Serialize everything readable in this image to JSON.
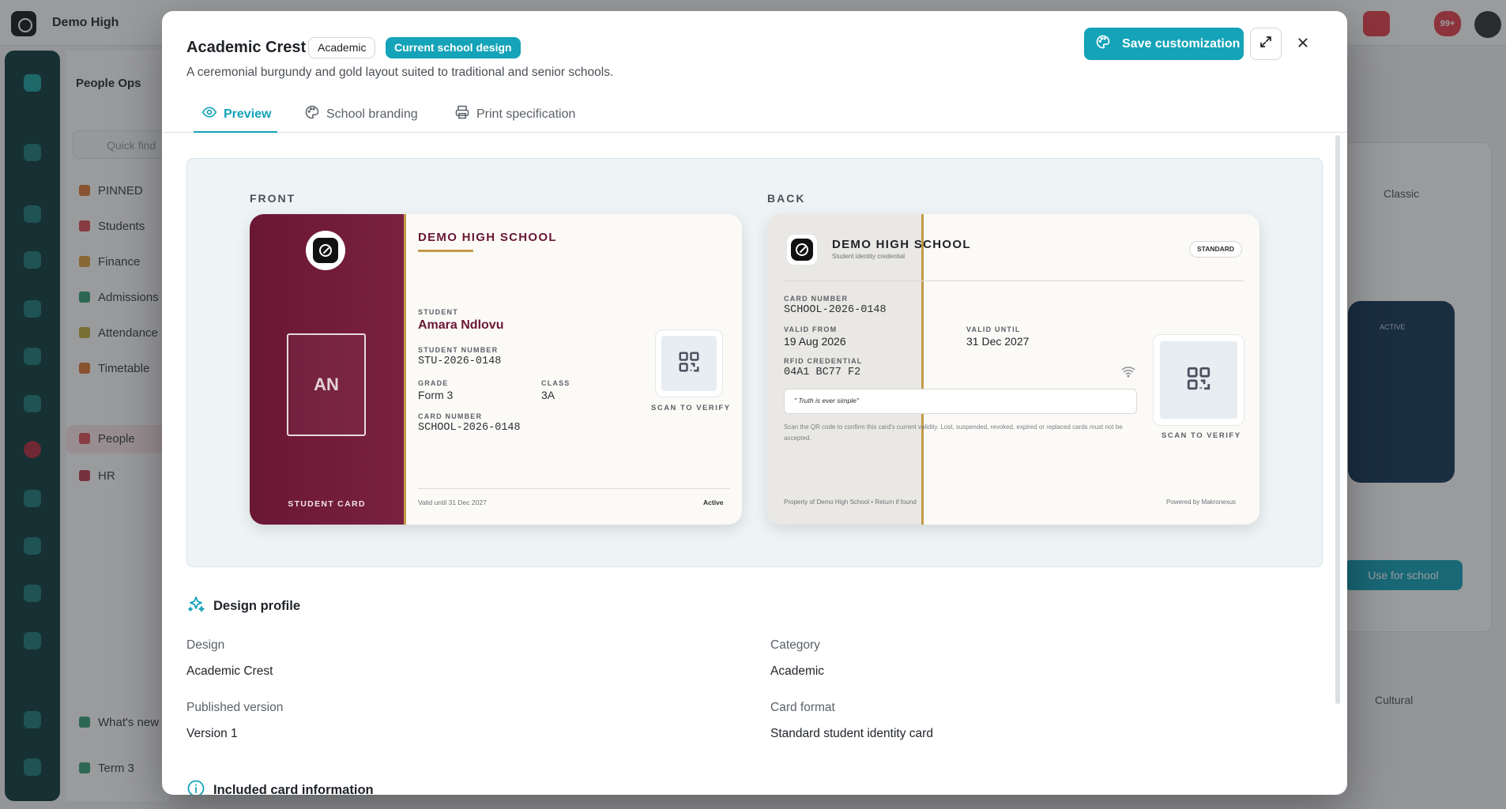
{
  "background": {
    "app_name": "Demo High",
    "section": "People Ops",
    "search_placeholder": "Quick find",
    "nav": [
      {
        "label": "PINNED",
        "color": "#e07a3a"
      },
      {
        "label": "Students",
        "color": "#e0505a"
      },
      {
        "label": "Finance",
        "color": "#e0a040"
      },
      {
        "label": "Admissions",
        "color": "#3aa07a"
      },
      {
        "label": "Attendance",
        "color": "#c0b040"
      },
      {
        "label": "Timetable",
        "color": "#e07a3a"
      },
      {
        "label": "People",
        "color": "#e0505a"
      },
      {
        "label": "HR",
        "color": "#c04050"
      }
    ],
    "whats_new": "What's new",
    "term": "Term 3",
    "notification_count": "99+",
    "right_panel": {
      "classic": "Classic",
      "active": "ACTIVE",
      "use_for_school": "Use for school",
      "cultural": "Cultural"
    }
  },
  "modal": {
    "title": "Academic Crest",
    "category_tag": "Academic",
    "current_tag": "Current school design",
    "subtitle": "A ceremonial burgundy and gold layout suited to traditional and senior schools.",
    "save_label": "Save customization",
    "tabs": [
      {
        "label": "Preview",
        "icon": "eye-icon",
        "active": true
      },
      {
        "label": "School branding",
        "icon": "palette-icon",
        "active": false
      },
      {
        "label": "Print specification",
        "icon": "printer-icon",
        "active": false
      }
    ]
  },
  "preview": {
    "front_label": "FRONT",
    "back_label": "BACK",
    "front": {
      "initials": "AN",
      "role": "STUDENT CARD",
      "school": "DEMO HIGH SCHOOL",
      "student_label": "STUDENT",
      "student_name": "Amara Ndlovu",
      "student_number_label": "STUDENT NUMBER",
      "student_number": "STU-2026-0148",
      "grade_label": "GRADE",
      "grade": "Form 3",
      "class_label": "CLASS",
      "class": "3A",
      "card_number_label": "CARD NUMBER",
      "card_number": "SCHOOL-2026-0148",
      "scan": "SCAN TO VERIFY",
      "valid_until": "Valid until 31 Dec 2027",
      "status": "Active"
    },
    "back": {
      "school": "DEMO HIGH SCHOOL",
      "credential": "Student identity credential",
      "badge": "STANDARD",
      "card_number_label": "CARD NUMBER",
      "card_number": "SCHOOL-2026-0148",
      "valid_from_label": "VALID FROM",
      "valid_from": "19 Aug 2026",
      "valid_until_label": "VALID UNTIL",
      "valid_until": "31 Dec 2027",
      "rfid_label": "RFID CREDENTIAL",
      "rfid": "04A1 BC77 F2",
      "motto": "\" Truth is ever simple\"",
      "note": "Scan the QR code to confirm this card's current validity. Lost, suspended, revoked, expired or replaced cards must not be accepted.",
      "scan": "SCAN TO VERIFY",
      "property": "Property of Demo High School • Return if found",
      "powered": "Powered by Makronexus"
    }
  },
  "profile": {
    "title": "Design profile",
    "design_label": "Design",
    "design": "Academic Crest",
    "category_label": "Category",
    "category": "Academic",
    "version_label": "Published version",
    "version": "Version 1",
    "format_label": "Card format",
    "format": "Standard student identity card",
    "included_title": "Included card information"
  },
  "colors": {
    "accent": "#14a3b8",
    "burgundy": "#6a1734",
    "gold": "#c49a48"
  }
}
